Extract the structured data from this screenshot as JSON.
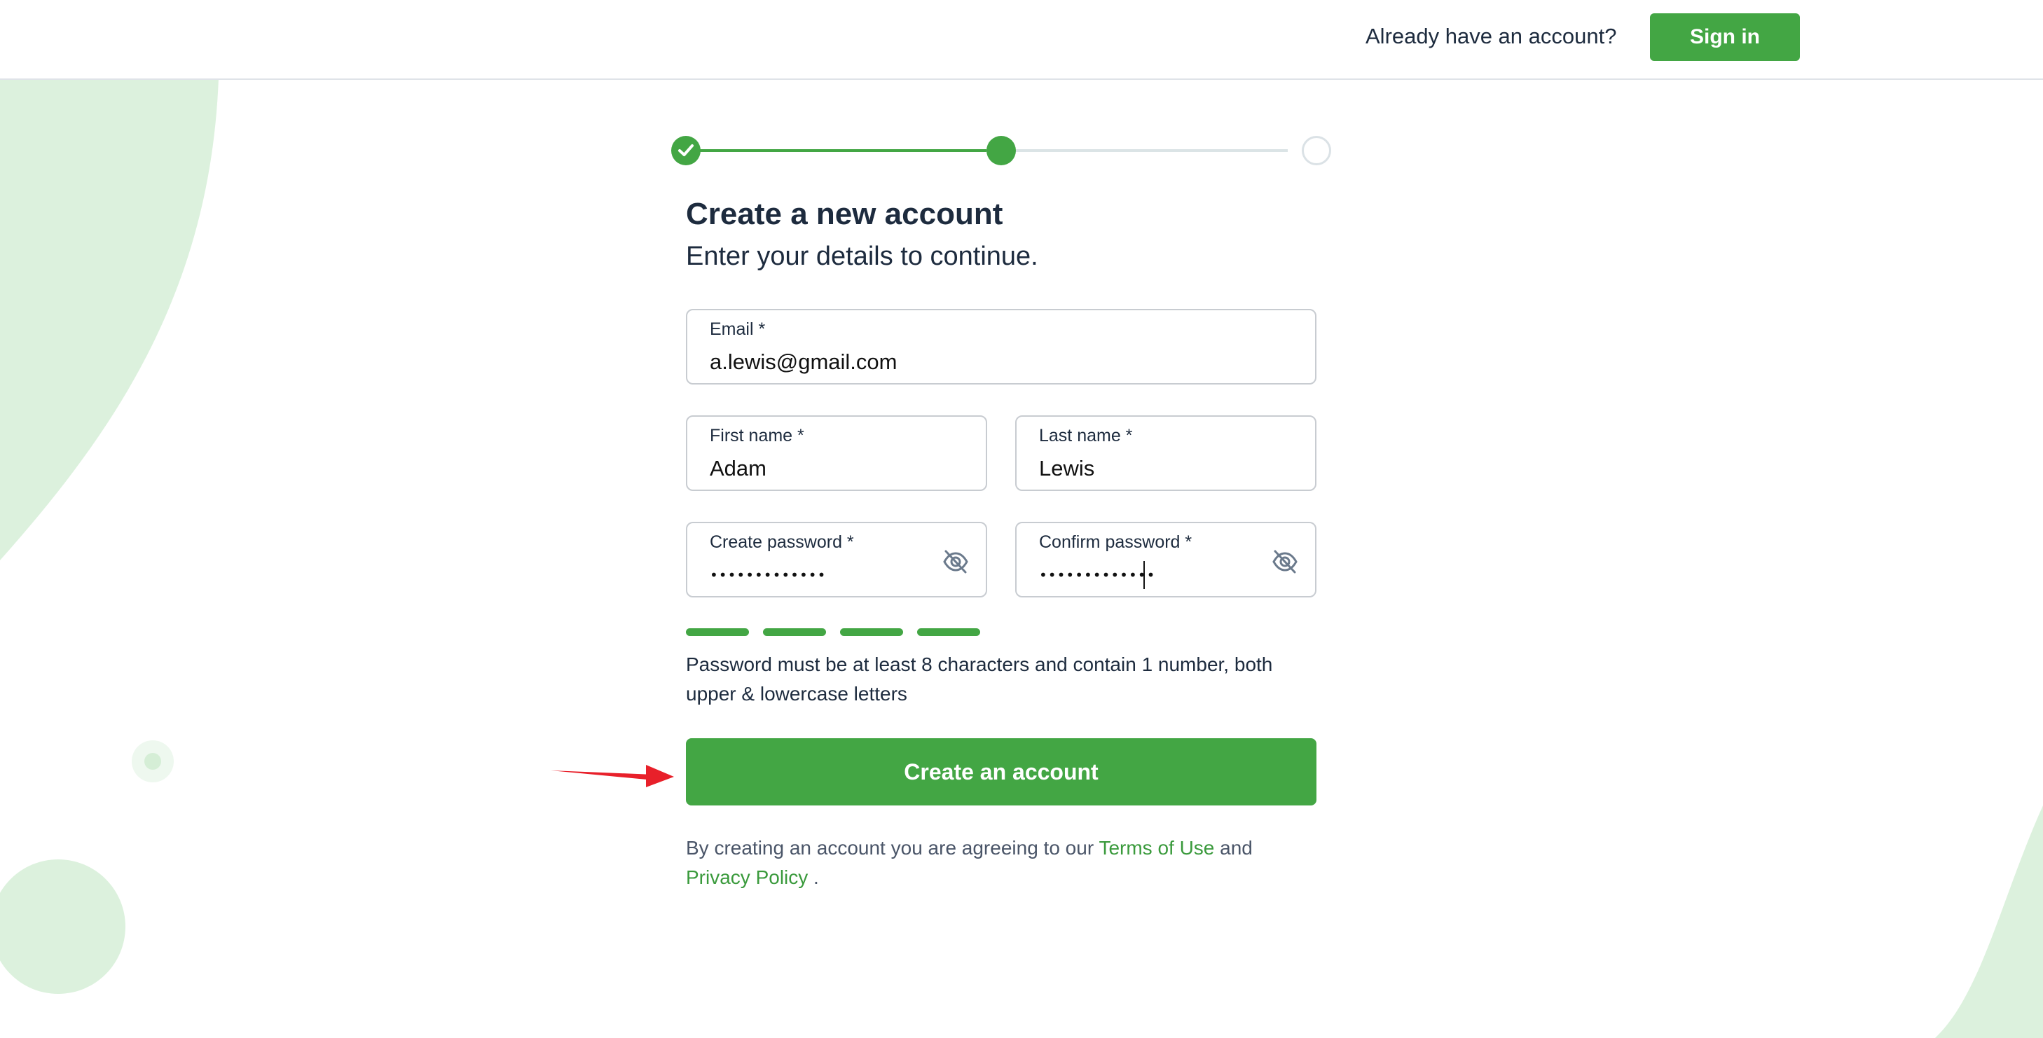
{
  "colors": {
    "accent": "#43a644",
    "text": "#1d2b3e",
    "decor": "#dcf1dd",
    "annotation_arrow": "#e8202a"
  },
  "header": {
    "prompt_text": "Already have an account?",
    "signin_label": "Sign in"
  },
  "stepper": {
    "steps": [
      "complete",
      "current",
      "upcoming"
    ]
  },
  "form": {
    "title": "Create a new account",
    "subtitle": "Enter your details to continue.",
    "email": {
      "label": "Email *",
      "value": "a.lewis@gmail.com"
    },
    "first_name": {
      "label": "First name *",
      "value": "Adam"
    },
    "last_name": {
      "label": "Last name *",
      "value": "Lewis"
    },
    "create_password": {
      "label": "Create password *",
      "value": "•••••••••••••",
      "icon": "eye-off-icon"
    },
    "confirm_password": {
      "label": "Confirm password *",
      "value": "•••••••••••••",
      "icon": "eye-off-icon"
    },
    "password_strength": {
      "filled_segments": 4,
      "total_segments": 4
    },
    "password_hint": "Password must be at least 8 characters and contain 1 number, both upper & lowercase letters",
    "submit_label": "Create an account",
    "terms": {
      "prefix": "By creating an account you are agreeing to our",
      "terms_link": "Terms of Use",
      "conjunction": "and",
      "privacy_link": "Privacy Policy",
      "suffix": "."
    }
  }
}
